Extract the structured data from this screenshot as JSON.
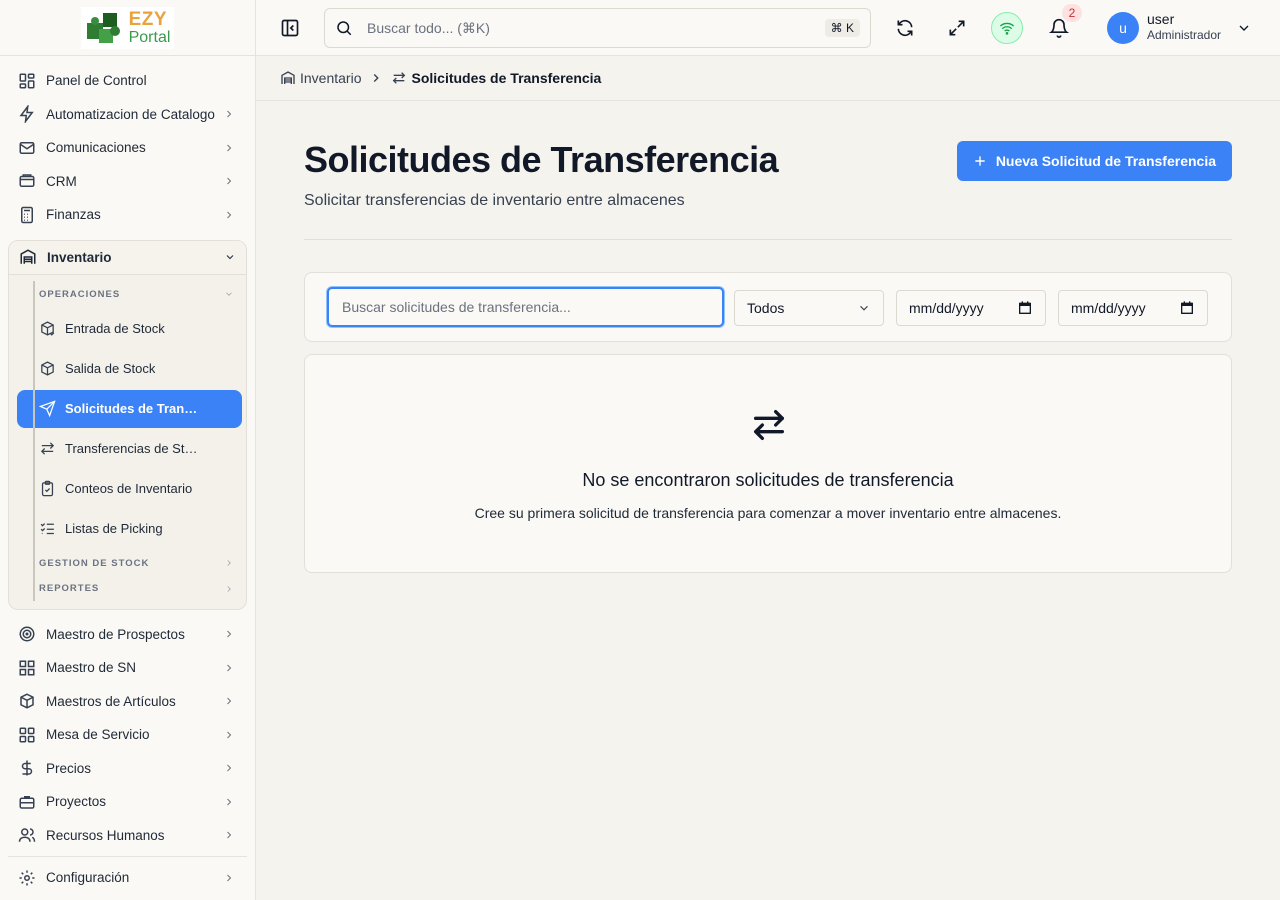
{
  "app": {
    "logo_top": "EZY",
    "logo_bottom": "Portal"
  },
  "sidebar": {
    "items_top": [
      {
        "label": "Panel de Control",
        "icon": "dashboard-icon",
        "has_chevron": false
      },
      {
        "label": "Automatizacion de Catalogo",
        "icon": "zap-icon",
        "has_chevron": true
      },
      {
        "label": "Comunicaciones",
        "icon": "mail-icon",
        "has_chevron": true
      },
      {
        "label": "CRM",
        "icon": "wallet-icon",
        "has_chevron": true
      },
      {
        "label": "Finanzas",
        "icon": "calculator-icon",
        "has_chevron": true
      }
    ],
    "group": {
      "label": "Inventario",
      "icon": "warehouse-icon",
      "section_operaciones": "OPERACIONES",
      "sub_items": [
        {
          "label": "Entrada de Stock",
          "icon": "package-in-icon",
          "active": false
        },
        {
          "label": "Salida de Stock",
          "icon": "package-out-icon",
          "active": false
        },
        {
          "label": "Solicitudes de Transferencia",
          "icon": "send-icon",
          "active": true
        },
        {
          "label": "Transferencias de Stock",
          "icon": "arrows-left-right-icon",
          "active": false
        },
        {
          "label": "Conteos de Inventario",
          "icon": "clipboard-check-icon",
          "active": false
        },
        {
          "label": "Listas de Picking",
          "icon": "list-checks-icon",
          "active": false
        }
      ],
      "section_gestion": "GESTION DE STOCK",
      "section_reportes": "REPORTES"
    },
    "items_bottom": [
      {
        "label": "Maestro de Prospectos",
        "icon": "target-icon"
      },
      {
        "label": "Maestro de SN",
        "icon": "grid-icon"
      },
      {
        "label": "Maestros de Artículos",
        "icon": "box-icon"
      },
      {
        "label": "Mesa de Servicio",
        "icon": "apps-icon"
      },
      {
        "label": "Precios",
        "icon": "dollar-icon"
      },
      {
        "label": "Proyectos",
        "icon": "briefcase-icon"
      },
      {
        "label": "Recursos Humanos",
        "icon": "users-icon"
      }
    ],
    "settings_label": "Configuración"
  },
  "topbar": {
    "search_placeholder": "Buscar todo... (⌘K)",
    "search_shortcut": "⌘ K",
    "notification_count": "2",
    "user_initial": "u",
    "user_name": "user",
    "user_role": "Administrador"
  },
  "breadcrumb": {
    "parent": "Inventario",
    "current": "Solicitudes de Transferencia"
  },
  "page": {
    "title": "Solicitudes de Transferencia",
    "subtitle": "Solicitar transferencias de inventario entre almacenes",
    "new_button": "Nueva Solicitud de Transferencia"
  },
  "filters": {
    "search_placeholder": "Buscar solicitudes de transferencia...",
    "status_value": "Todos",
    "date_from": "mm/dd/yyyy",
    "date_to": "mm/dd/yyyy"
  },
  "empty_state": {
    "title": "No se encontraron solicitudes de transferencia",
    "text": "Cree su primera solicitud de transferencia para comenzar a mover inventario entre almacenes."
  },
  "colors": {
    "accent": "#3b82f6",
    "online": "#16a34a",
    "badge": "#dc2626"
  }
}
